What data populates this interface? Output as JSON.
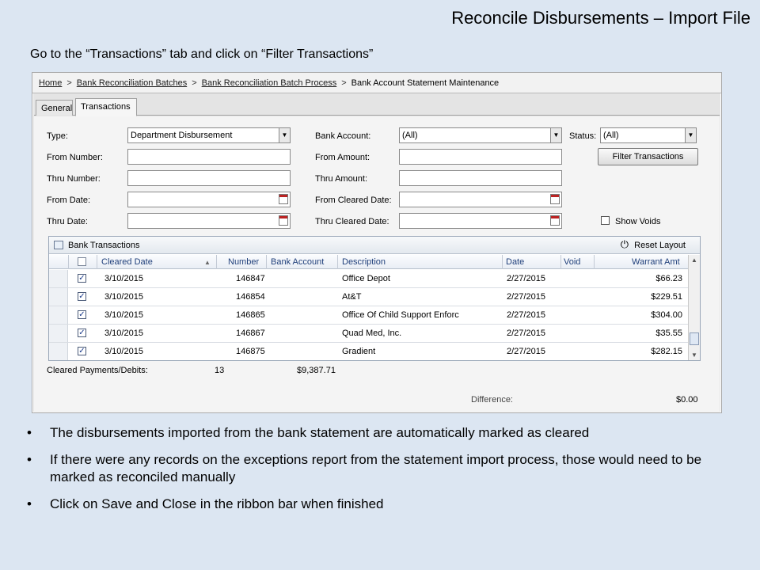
{
  "slide": {
    "title": "Reconcile Disbursements – Import File",
    "instruction": "Go to the “Transactions” tab and click on “Filter Transactions”"
  },
  "breadcrumb": [
    "Home",
    "Bank Reconciliation Batches",
    "Bank Reconciliation Batch Process",
    "Bank Account Statement Maintenance"
  ],
  "tabs": [
    "General",
    "Transactions"
  ],
  "form": {
    "type_label": "Type:",
    "type_value": "Department Disbursement",
    "from_number_label": "From Number:",
    "thru_number_label": "Thru Number:",
    "from_date_label": "From Date:",
    "thru_date_label": "Thru Date:",
    "bank_account_label": "Bank Account:",
    "bank_account_value": "(All)",
    "from_amount_label": "From Amount:",
    "thru_amount_label": "Thru Amount:",
    "from_cleared_date_label": "From Cleared Date:",
    "thru_cleared_date_label": "Thru Cleared Date:",
    "status_label": "Status:",
    "status_value": "(All)",
    "filter_button": "Filter Transactions",
    "show_voids_label": "Show Voids"
  },
  "grid": {
    "title": "Bank Transactions",
    "reset_layout": "Reset Layout",
    "columns": [
      "Cleared Date",
      "Number",
      "Bank Account",
      "Description",
      "Date",
      "Void",
      "Warrant Amt"
    ],
    "rows": [
      {
        "cleared_date": "3/10/2015",
        "number": "146847",
        "description": "Office Depot",
        "date": "2/27/2015",
        "amount": "$66.23"
      },
      {
        "cleared_date": "3/10/2015",
        "number": "146854",
        "description": "At&T",
        "date": "2/27/2015",
        "amount": "$229.51"
      },
      {
        "cleared_date": "3/10/2015",
        "number": "146865",
        "description": "Office Of Child Support Enforc",
        "date": "2/27/2015",
        "amount": "$304.00"
      },
      {
        "cleared_date": "3/10/2015",
        "number": "146867",
        "description": "Quad Med, Inc.",
        "date": "2/27/2015",
        "amount": "$35.55"
      },
      {
        "cleared_date": "3/10/2015",
        "number": "146875",
        "description": "Gradient",
        "date": "2/27/2015",
        "amount": "$282.15"
      }
    ]
  },
  "summary": {
    "cleared_label": "Cleared Payments/Debits:",
    "cleared_count": "13",
    "cleared_total": "$9,387.71",
    "difference_label": "Difference:",
    "difference_value": "$0.00"
  },
  "bullets": [
    "The disbursements imported from the bank statement are automatically marked as cleared",
    "If there were any records on the exceptions report from the statement import process, those would need to be marked as reconciled manually",
    "Click on Save and Close in the ribbon bar when finished"
  ]
}
